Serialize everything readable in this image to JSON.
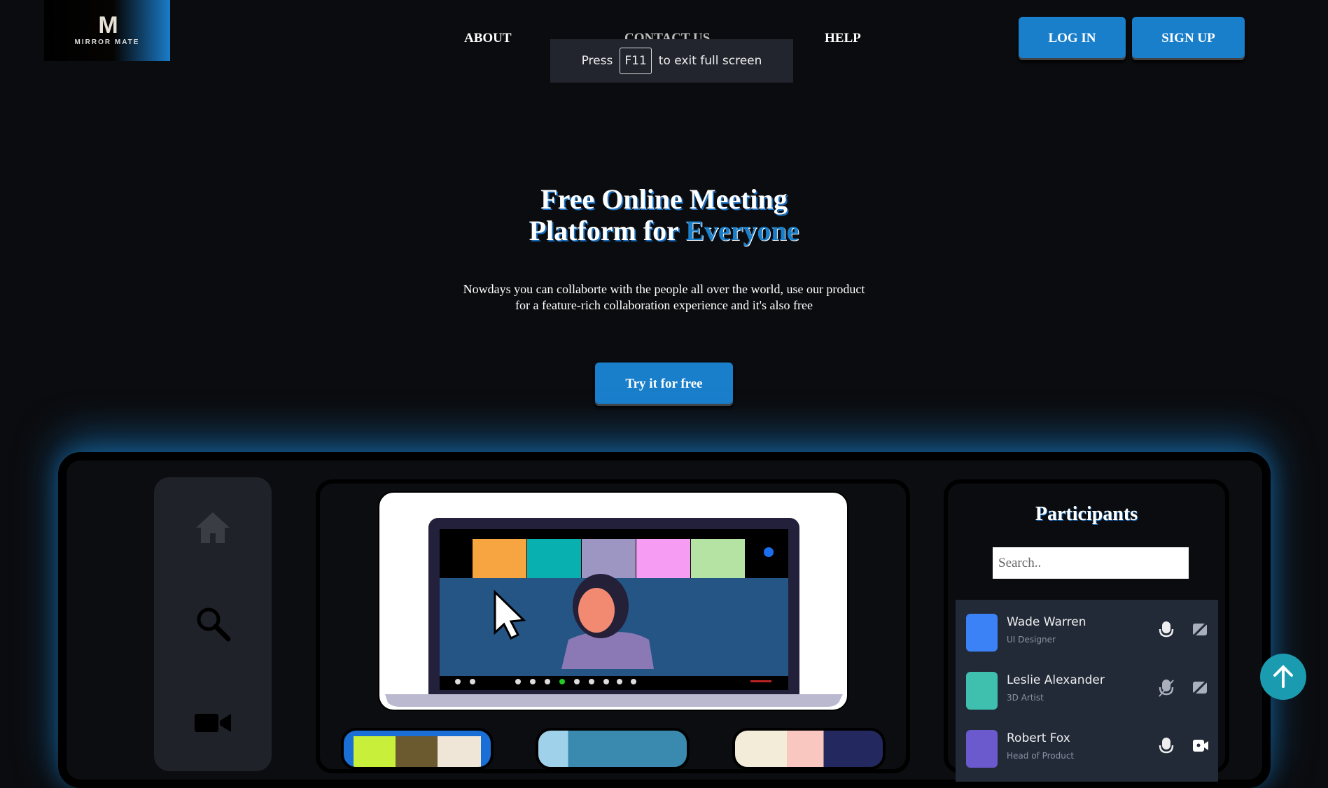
{
  "logo": {
    "mark": "M",
    "text": "MIRROR MATE"
  },
  "nav": {
    "about": "ABOUT",
    "contact": "CONTACT US",
    "help": "HELP"
  },
  "auth": {
    "login": "LOG IN",
    "signup": "SIGN UP"
  },
  "toast": {
    "press": "Press",
    "key": "F11",
    "rest": "to exit full screen"
  },
  "hero": {
    "title_line1": "Free Online Meeting",
    "title_line2_a": "Platform for",
    "title_line2_b": "Everyone",
    "desc_line1": "Nowdays you can collaborte with the people all over the world, use our product",
    "desc_line2": "for a feature-rich collaboration experience and it's also free",
    "cta": "Try it for free"
  },
  "participants": {
    "title": "Participants",
    "search_placeholder": "Search..",
    "items": [
      {
        "name": "Wade Warren",
        "role": "UI Designer",
        "mic": "on",
        "camera": "off",
        "color": "#3b82f6"
      },
      {
        "name": "Leslie Alexander",
        "role": "3D Artist",
        "mic": "off",
        "camera": "off",
        "color": "#3fbfad"
      },
      {
        "name": "Robert Fox",
        "role": "Head of Product",
        "mic": "on",
        "camera": "on",
        "color": "#6a5acd"
      }
    ]
  },
  "colors": {
    "accent": "#1a7fcb",
    "bg": "#0b0c0f",
    "teal": "#1a9bb0"
  }
}
